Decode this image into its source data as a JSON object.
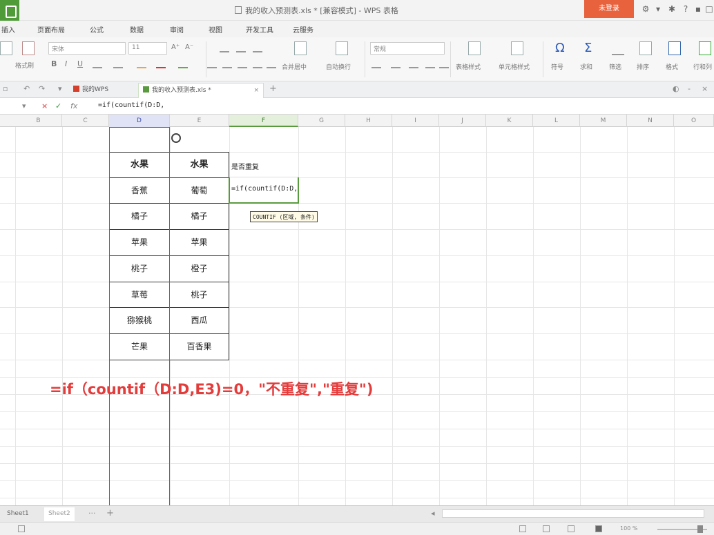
{
  "window": {
    "title": "我的收入预测表.xls * [兼容模式] - WPS 表格",
    "login_label": "未登录"
  },
  "menu": [
    "插入",
    "页面布局",
    "公式",
    "数据",
    "审阅",
    "视图",
    "开发工具",
    "云服务"
  ],
  "ribbon": {
    "font_name": "宋体",
    "font_size": "11",
    "number_format": "常规",
    "labels": {
      "format_painter": "格式刷",
      "merge_center": "合并居中",
      "wrap_text": "自动换行",
      "table_style": "表格样式",
      "cell_style": "单元格样式",
      "symbol": "符号",
      "sum": "求和",
      "filter": "筛选",
      "sort": "排序",
      "format": "格式",
      "rows_cols": "行和列"
    }
  },
  "tabs": [
    {
      "label": "我的WPS"
    },
    {
      "label": "我的收入预测表.xls *"
    }
  ],
  "formula_bar": {
    "value": "=if(countif(D:D,"
  },
  "columns": [
    "B",
    "C",
    "D",
    "E",
    "F",
    "G",
    "H",
    "I",
    "J",
    "K",
    "L",
    "M",
    "N",
    "O"
  ],
  "table": {
    "headers": [
      "水果",
      "水果"
    ],
    "rows": [
      [
        "香蕉",
        "葡萄"
      ],
      [
        "橘子",
        "橘子"
      ],
      [
        "苹果",
        "苹果"
      ],
      [
        "桃子",
        "橙子"
      ],
      [
        "草莓",
        "桃子"
      ],
      [
        "猕猴桃",
        "西瓜"
      ],
      [
        "芒果",
        "百香果"
      ]
    ]
  },
  "col_f": {
    "header": "是否重复",
    "editing": "=if(countif(D:D,"
  },
  "tooltip": "COUNTIF (区域, 条件)",
  "annotation": "=if（countif（D:D,E3)=0，\"不重复\",\"重复\")",
  "sheets": [
    "Sheet1",
    "Sheet2"
  ],
  "status": {
    "zoom": "100 %"
  }
}
